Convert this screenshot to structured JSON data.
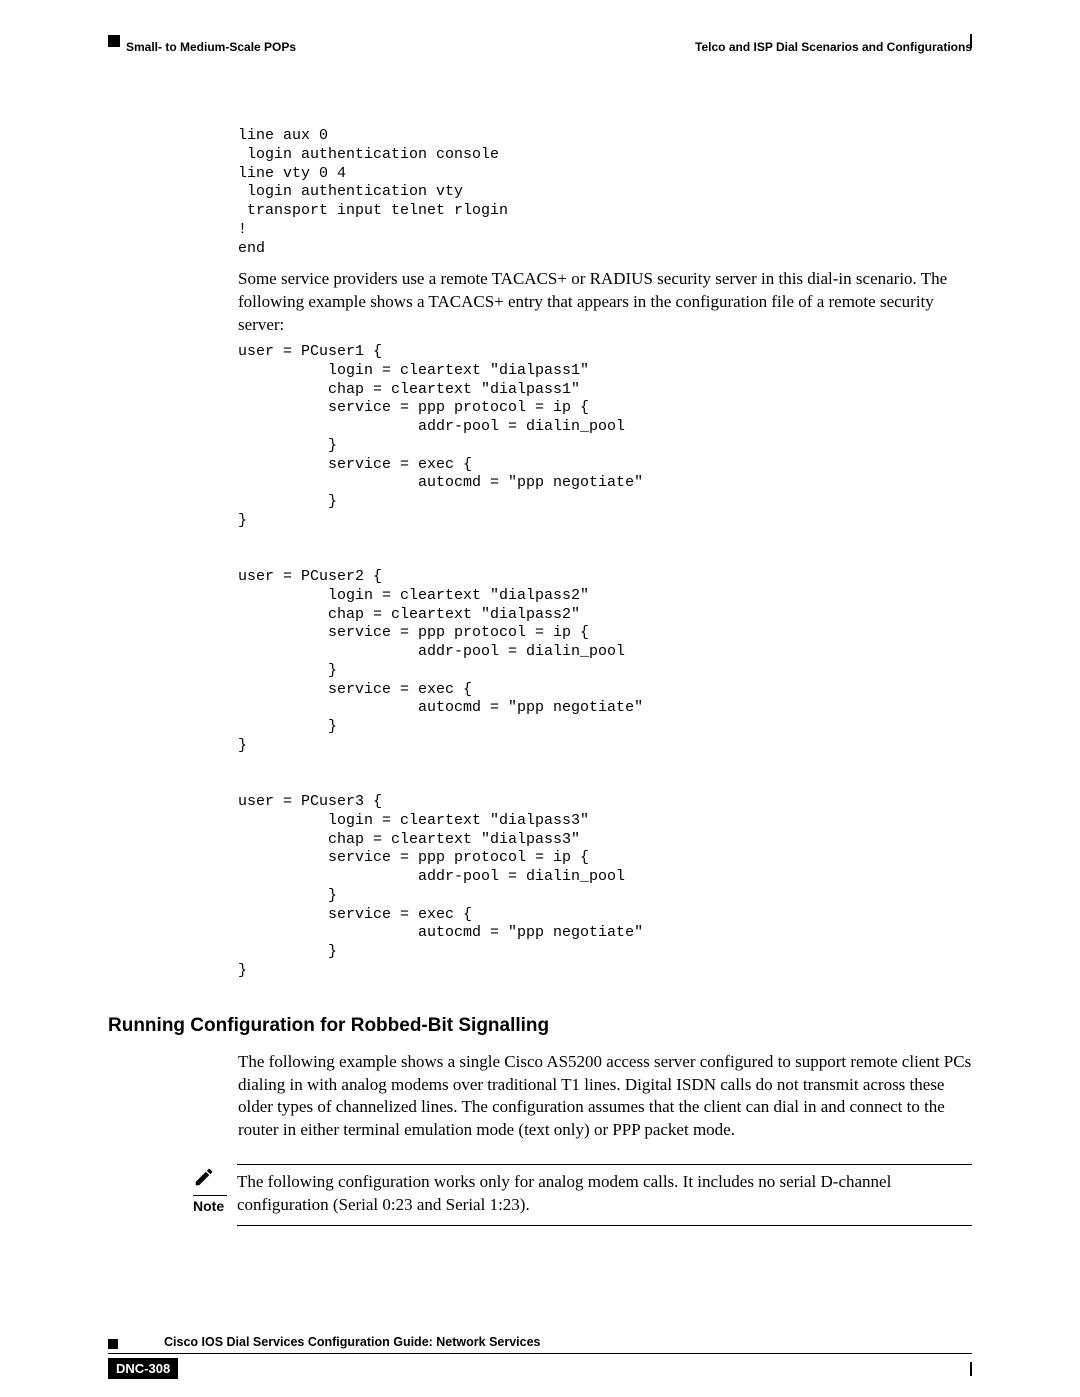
{
  "header": {
    "left": "Small- to Medium-Scale POPs",
    "right": "Telco and ISP Dial Scenarios and Configurations"
  },
  "code_block_1": "line aux 0\n login authentication console\nline vty 0 4\n login authentication vty\n transport input telnet rlogin\n!\nend",
  "paragraph_1": "Some service providers use a remote TACACS+ or RADIUS security server in this dial-in scenario. The following example shows a TACACS+ entry that appears in the configuration file of a remote security server:",
  "code_block_2": "user = PCuser1 {\n          login = cleartext \"dialpass1\"\n          chap = cleartext \"dialpass1\"\n          service = ppp protocol = ip {\n                    addr-pool = dialin_pool\n          }\n          service = exec {\n                    autocmd = \"ppp negotiate\"\n          }\n}\n\n\nuser = PCuser2 {\n          login = cleartext \"dialpass2\"\n          chap = cleartext \"dialpass2\"\n          service = ppp protocol = ip {\n                    addr-pool = dialin_pool\n          }\n          service = exec {\n                    autocmd = \"ppp negotiate\"\n          }\n}\n\n\nuser = PCuser3 {\n          login = cleartext \"dialpass3\"\n          chap = cleartext \"dialpass3\"\n          service = ppp protocol = ip {\n                    addr-pool = dialin_pool\n          }\n          service = exec {\n                    autocmd = \"ppp negotiate\"\n          }\n}",
  "heading_2": "Running Configuration for Robbed-Bit Signalling",
  "paragraph_2": "The following example shows a single Cisco AS5200 access server configured to support remote client PCs dialing in with analog modems over traditional T1 lines. Digital ISDN calls do not transmit across these older types of channelized lines. The configuration assumes that the client can dial in and connect to the router in either terminal emulation mode (text only) or PPP packet mode.",
  "note": {
    "label": "Note",
    "text": "The following configuration works only for analog modem calls. It includes no serial D-channel configuration (Serial 0:23 and Serial 1:23)."
  },
  "footer": {
    "title": "Cisco IOS Dial Services Configuration Guide: Network Services",
    "page": "DNC-308"
  }
}
